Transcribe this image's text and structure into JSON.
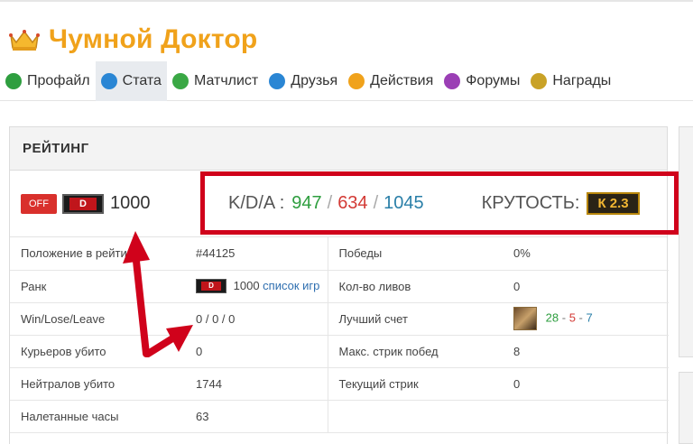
{
  "profile": {
    "name": "Чумной Доктор"
  },
  "nav": [
    {
      "label": "Профайл",
      "icon": "profile-icon",
      "color": "#2e9e3f"
    },
    {
      "label": "Стата",
      "icon": "stats-icon",
      "color": "#2a86d4",
      "active": true
    },
    {
      "label": "Матчлист",
      "icon": "matchlist-icon",
      "color": "#3aa845"
    },
    {
      "label": "Друзья",
      "icon": "friends-icon",
      "color": "#2a86d4"
    },
    {
      "label": "Действия",
      "icon": "actions-icon",
      "color": "#f0a21b"
    },
    {
      "label": "Форумы",
      "icon": "forums-icon",
      "color": "#9b3fb5"
    },
    {
      "label": "Награды",
      "icon": "rewards-icon",
      "color": "#c9a227"
    }
  ],
  "rating": {
    "header": "РЕЙТИНГ",
    "off_label": "OFF",
    "rank_letter": "D",
    "value": "1000",
    "kda": {
      "label": "K/D/A :",
      "kills": "947",
      "deaths": "634",
      "assists": "1045",
      "sep": "/"
    },
    "coolness": {
      "label": "КРУТОСТЬ:",
      "value": "К 2.3"
    }
  },
  "stats_rows": [
    {
      "l1": "Положение в рейтинге",
      "v1": "#44125",
      "l2": "Победы",
      "v2": "0%"
    },
    {
      "l1": "Ранк",
      "v1": "1000",
      "v1_link": "список игр",
      "l2": "Кол-во ливов",
      "v2": "0"
    },
    {
      "l1": "Win/Lose/Leave",
      "v1": "0 / 0 / 0",
      "l2": "Лучший счет",
      "best_k": "28",
      "best_d": "5",
      "best_a": "7",
      "score_sep": "-"
    },
    {
      "l1": "Курьеров убито",
      "v1": "0",
      "l2": "Макс. стрик побед",
      "v2": "8"
    },
    {
      "l1": "Нейтралов убито",
      "v1": "1744",
      "l2": "Текущий стрик",
      "v2": "0"
    },
    {
      "l1": "Налетанные часы",
      "v1": "63",
      "l2": "",
      "v2": ""
    }
  ],
  "colors": {
    "accent": "#f0a21b",
    "highlight": "#d0021b",
    "kills": "#2e9e3f",
    "deaths": "#d33a35",
    "assists": "#2a7fa8"
  }
}
